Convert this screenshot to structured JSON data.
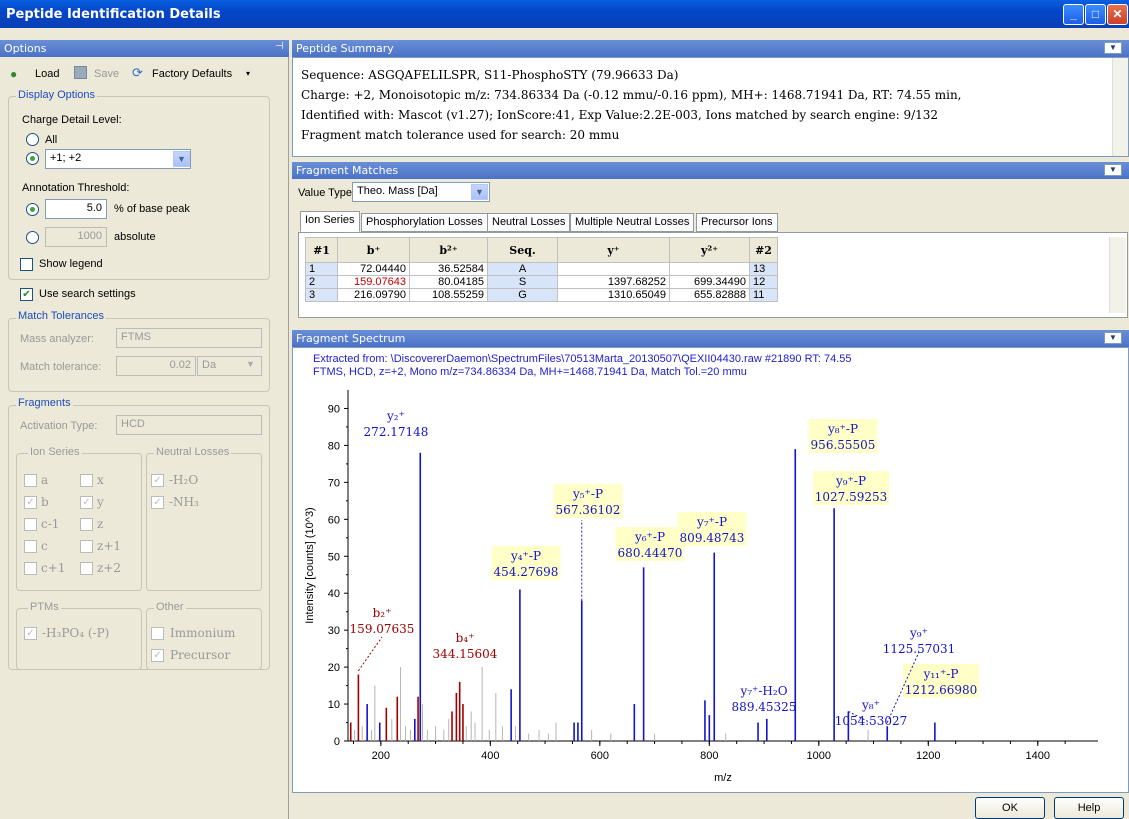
{
  "window": {
    "title": "Peptide Identification Details"
  },
  "options": {
    "header": "Options",
    "pin": "ᵖ",
    "load": "Load",
    "save": "Save",
    "factory": "Factory Defaults",
    "display_group": "Display Options",
    "charge_label": "Charge Detail Level:",
    "all": "All",
    "charge_value": "+1; +2",
    "annot_label": "Annotation Threshold:",
    "pct_value": "5.0",
    "pct_unit": "% of base peak",
    "abs_value": "1000",
    "abs_unit": "absolute",
    "show_legend": "Show legend",
    "use_search": "Use search settings",
    "match_group": "Match Tolerances",
    "mass_analyzer_label": "Mass analyzer:",
    "mass_analyzer": "FTMS",
    "match_tol_label": "Match tolerance:",
    "match_tol": "0.02",
    "match_unit": "Da",
    "frag_group": "Fragments",
    "activation_label": "Activation Type:",
    "activation": "HCD",
    "ion_series_group": "Ion Series",
    "ions": [
      "a",
      "x",
      "b",
      "y",
      "c-1",
      "z",
      "c",
      "z+1",
      "c+1",
      "z+2"
    ],
    "neutral_group": "Neutral Losses",
    "nl1": "-H₂O",
    "nl2": "-NH₃",
    "ptms_group": "PTMs",
    "ptm1": "-H₃PO₄ (-P)",
    "other_group": "Other",
    "other1": "Immonium",
    "other2": "Precursor"
  },
  "summary": {
    "header": "Peptide Summary",
    "line1": "Sequence: ASGQAFELILSPR, S11-PhosphoSTY (79.96633 Da)",
    "line2": "Charge: +2,   Monoisotopic m/z: 734.86334 Da (-0.12 mmu/-0.16 ppm),   MH+: 1468.71941 Da,   RT: 74.55 min,",
    "line3": "Identified with: Mascot (v1.27); IonScore:41, Exp Value:2.2E-003, Ions matched by search engine: 9/132",
    "line4": "Fragment match tolerance used for search: 20 mmu"
  },
  "fragments": {
    "header": "Fragment Matches",
    "value_type_label": "Value Type:",
    "value_type": "Theo. Mass [Da]",
    "tabs": [
      "Ion Series",
      "Phosphorylation Losses",
      "Neutral Losses",
      "Multiple Neutral Losses",
      "Precursor Ions"
    ],
    "columns": [
      "#1",
      "b⁺",
      "b²⁺",
      "Seq.",
      "y⁺",
      "y²⁺",
      "#2"
    ],
    "rows": [
      [
        "1",
        "72.04440",
        "36.52584",
        "A",
        "",
        "",
        "13"
      ],
      [
        "2",
        "159.07643",
        "80.04185",
        "S",
        "1397.68252",
        "699.34490",
        "12"
      ],
      [
        "3",
        "216.09790",
        "108.55259",
        "G",
        "1310.65049",
        "655.82888",
        "11"
      ]
    ]
  },
  "spectrum": {
    "header": "Fragment Spectrum",
    "info1": "Extracted from: \\DiscovererDaemon\\SpectrumFiles\\70513Marta_20130507\\QEXII04430.raw  #21890  RT: 74.55",
    "info2": "FTMS, HCD, z=+2, Mono m/z=734.86334 Da, MH+=1468.71941 Da, Match Tol.=20 mmu",
    "xlabel": "m/z",
    "ylabel": "Intensity [counts] (10^3)"
  },
  "chart_data": {
    "type": "bar",
    "xlabel": "m/z",
    "ylabel": "Intensity [counts] (10^3)",
    "xlim": [
      140,
      1510
    ],
    "ylim": [
      0,
      95
    ],
    "xticks": [
      200,
      400,
      600,
      800,
      1000,
      1200,
      1400
    ],
    "yticks": [
      0,
      10,
      20,
      30,
      40,
      50,
      60,
      70,
      80,
      90
    ],
    "colors": {
      "blue": "#1414c8",
      "red": "#a00000",
      "gray": "#b4b4b4"
    },
    "peaks": [
      {
        "x": 145,
        "y": 5,
        "c": "red"
      },
      {
        "x": 152,
        "y": 3,
        "c": "gray"
      },
      {
        "x": 159,
        "y": 18,
        "c": "red"
      },
      {
        "x": 166,
        "y": 4,
        "c": "gray"
      },
      {
        "x": 175,
        "y": 10,
        "c": "blue"
      },
      {
        "x": 183,
        "y": 3,
        "c": "gray"
      },
      {
        "x": 189,
        "y": 15,
        "c": "gray"
      },
      {
        "x": 198,
        "y": 5,
        "c": "blue"
      },
      {
        "x": 210,
        "y": 9,
        "c": "red"
      },
      {
        "x": 220,
        "y": 6,
        "c": "gray"
      },
      {
        "x": 230,
        "y": 12,
        "c": "red"
      },
      {
        "x": 236,
        "y": 20,
        "c": "gray"
      },
      {
        "x": 245,
        "y": 4,
        "c": "gray"
      },
      {
        "x": 254,
        "y": 3,
        "c": "gray"
      },
      {
        "x": 262,
        "y": 6,
        "c": "blue"
      },
      {
        "x": 268,
        "y": 12,
        "c": "red"
      },
      {
        "x": 272,
        "y": 78,
        "c": "blue"
      },
      {
        "x": 276,
        "y": 10,
        "c": "gray"
      },
      {
        "x": 285,
        "y": 3,
        "c": "gray"
      },
      {
        "x": 300,
        "y": 4,
        "c": "gray"
      },
      {
        "x": 315,
        "y": 3,
        "c": "gray"
      },
      {
        "x": 324,
        "y": 6,
        "c": "gray"
      },
      {
        "x": 330,
        "y": 8,
        "c": "red"
      },
      {
        "x": 338,
        "y": 13,
        "c": "red"
      },
      {
        "x": 344,
        "y": 16,
        "c": "red"
      },
      {
        "x": 350,
        "y": 10,
        "c": "red"
      },
      {
        "x": 356,
        "y": 4,
        "c": "gray"
      },
      {
        "x": 365,
        "y": 8,
        "c": "gray"
      },
      {
        "x": 372,
        "y": 5,
        "c": "gray"
      },
      {
        "x": 385,
        "y": 20,
        "c": "gray"
      },
      {
        "x": 398,
        "y": 3,
        "c": "gray"
      },
      {
        "x": 410,
        "y": 13,
        "c": "gray"
      },
      {
        "x": 422,
        "y": 4,
        "c": "gray"
      },
      {
        "x": 438,
        "y": 14,
        "c": "blue"
      },
      {
        "x": 446,
        "y": 4,
        "c": "gray"
      },
      {
        "x": 454,
        "y": 41,
        "c": "blue"
      },
      {
        "x": 470,
        "y": 2,
        "c": "gray"
      },
      {
        "x": 489,
        "y": 3,
        "c": "gray"
      },
      {
        "x": 506,
        "y": 2,
        "c": "gray"
      },
      {
        "x": 520,
        "y": 5,
        "c": "gray"
      },
      {
        "x": 553,
        "y": 5,
        "c": "blue"
      },
      {
        "x": 560,
        "y": 5,
        "c": "blue"
      },
      {
        "x": 567,
        "y": 38,
        "c": "blue"
      },
      {
        "x": 585,
        "y": 3,
        "c": "gray"
      },
      {
        "x": 620,
        "y": 2,
        "c": "gray"
      },
      {
        "x": 663,
        "y": 10,
        "c": "blue"
      },
      {
        "x": 680,
        "y": 47,
        "c": "blue"
      },
      {
        "x": 700,
        "y": 2,
        "c": "gray"
      },
      {
        "x": 792,
        "y": 11,
        "c": "blue"
      },
      {
        "x": 800,
        "y": 7,
        "c": "blue"
      },
      {
        "x": 809,
        "y": 51,
        "c": "blue"
      },
      {
        "x": 830,
        "y": 2,
        "c": "gray"
      },
      {
        "x": 889,
        "y": 5,
        "c": "blue"
      },
      {
        "x": 905,
        "y": 6,
        "c": "blue"
      },
      {
        "x": 957,
        "y": 79,
        "c": "blue"
      },
      {
        "x": 1028,
        "y": 63,
        "c": "blue"
      },
      {
        "x": 1054,
        "y": 8,
        "c": "blue"
      },
      {
        "x": 1090,
        "y": 3,
        "c": "gray"
      },
      {
        "x": 1125,
        "y": 4,
        "c": "blue"
      },
      {
        "x": 1212,
        "y": 5,
        "c": "blue"
      }
    ],
    "annotations": [
      {
        "ion": "y₂⁺",
        "mz": "272.17148",
        "x": 272,
        "c": "blue",
        "box": false
      },
      {
        "ion": "b₂⁺",
        "mz": "159.07635",
        "x": 159,
        "c": "red",
        "box": false
      },
      {
        "ion": "b₄⁺",
        "mz": "344.15604",
        "x": 344,
        "c": "red",
        "box": false
      },
      {
        "ion": "y₄⁺-P",
        "mz": "454.27698",
        "x": 454,
        "c": "blue",
        "box": true
      },
      {
        "ion": "y₅⁺-P",
        "mz": "567.36102",
        "x": 567,
        "c": "blue",
        "box": true
      },
      {
        "ion": "y₆⁺-P",
        "mz": "680.44470",
        "x": 680,
        "c": "blue",
        "box": true
      },
      {
        "ion": "y₇⁺-P",
        "mz": "809.48743",
        "x": 809,
        "c": "blue",
        "box": true
      },
      {
        "ion": "y₇⁺-H₂O",
        "mz": "889.45325",
        "x": 889,
        "c": "blue",
        "box": false
      },
      {
        "ion": "y₈⁺-P",
        "mz": "956.55505",
        "x": 956,
        "c": "blue",
        "box": true
      },
      {
        "ion": "y₉⁺-P",
        "mz": "1027.59253",
        "x": 1027,
        "c": "blue",
        "box": true
      },
      {
        "ion": "y₈⁺",
        "mz": "1054.53027",
        "x": 1054,
        "c": "blue",
        "box": false
      },
      {
        "ion": "y₉⁺",
        "mz": "1125.57031",
        "x": 1125,
        "c": "blue",
        "box": false
      },
      {
        "ion": "y₁₁⁺-P",
        "mz": "1212.66980",
        "x": 1212,
        "c": "blue",
        "box": true
      }
    ]
  },
  "buttons": {
    "ok": "OK",
    "help": "Help"
  }
}
